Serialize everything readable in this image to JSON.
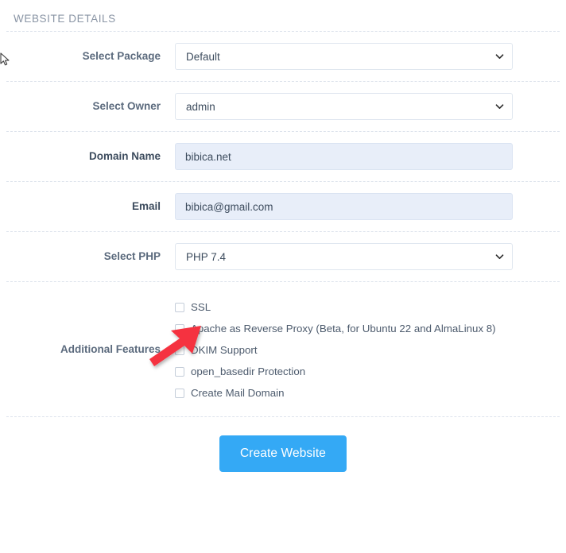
{
  "panel": {
    "title": "WEBSITE DETAILS"
  },
  "form": {
    "rows": [
      {
        "label": "Select Package",
        "value": "Default"
      },
      {
        "label": "Select Owner",
        "value": "admin"
      },
      {
        "label": "Domain Name",
        "value": "bibica.net"
      },
      {
        "label": "Email",
        "value": "bibica@gmail.com"
      },
      {
        "label": "Select PHP",
        "value": "PHP 7.4"
      }
    ],
    "package_options": [
      "Default"
    ],
    "owner_options": [
      "admin"
    ],
    "php_options": [
      "PHP 7.4"
    ],
    "domain_placeholder": "",
    "email_placeholder": "",
    "additional_features_label": "Additional Features",
    "features": [
      {
        "label": "SSL",
        "checked": false
      },
      {
        "label": "Apache as Reverse Proxy (Beta, for Ubuntu 22 and AlmaLinux 8)",
        "checked": false
      },
      {
        "label": "DKIM Support",
        "checked": false
      },
      {
        "label": "open_basedir Protection",
        "checked": false
      },
      {
        "label": "Create Mail Domain",
        "checked": false
      }
    ],
    "submit_label": "Create Website"
  },
  "annotation": {
    "arrow_color": "#f5333f",
    "points_to": "Select PHP"
  },
  "colors": {
    "accent": "#34a9f5",
    "input_background": "#e8eef9",
    "label_text": "#5b6a7d",
    "title_text": "#8a95a5",
    "separator": "#dde3ec"
  }
}
